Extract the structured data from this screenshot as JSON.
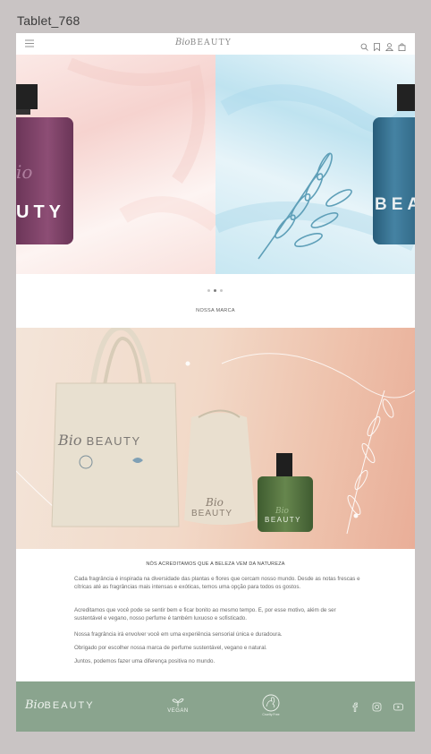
{
  "frame_label": "Tablet_768",
  "nav": {
    "menu_icon": "hamburger-icon",
    "logo_script": "Bio",
    "logo_text": "BEAUTY",
    "icons": [
      "search-icon",
      "bookmark-icon",
      "user-icon",
      "bag-icon"
    ]
  },
  "hero": {
    "left_text": "UTY",
    "right_text": "BEA",
    "active_slide": 2,
    "slide_count": 3
  },
  "section_title": "NOSSA MARCA",
  "brand_image": {
    "bag_script": "Bio",
    "bag_text": "BEAUTY",
    "pouch_script": "Bio",
    "pouch_text": "BEAUTY",
    "bottle_script": "Bio",
    "bottle_text": "BEAUTY"
  },
  "headline": "NÓS ACREDITAMOS QUE A BELEZA VEM DA NATUREZA",
  "paragraphs": [
    "Cada fragrância é inspirada na diversidade das plantas e flores que cercam nosso mundo. Desde as notas frescas e cítricas até as fragrâncias mais intensas e exóticas, temos uma opção para todos os gostos.",
    "Acreditamos que você pode se sentir bem e ficar bonito ao mesmo tempo. E, por esse motivo, além de ser sustentável e vegano, nosso perfume é também luxuoso e sofisticado.",
    "Nossa fragrância irá envolver você em uma experiência sensorial única e duradoura.",
    "Obrigado por escolher nossa marca de perfume sustentável, vegano e natural.",
    "Juntos, podemos fazer uma diferença positiva no mundo."
  ],
  "footer": {
    "logo_script": "Bio",
    "logo_text": "BEAUTY",
    "vegan_label": "VEGAN",
    "cruelty_label": "Cruelty Free",
    "socials": [
      "facebook-icon",
      "instagram-icon",
      "youtube-icon"
    ]
  },
  "colors": {
    "background": "#c9c4c4",
    "footer": "#8aa48e",
    "purple_bottle": "#7a3f64",
    "blue_bottle": "#2f6b8b",
    "green_bottle": "#4f6e3d"
  }
}
